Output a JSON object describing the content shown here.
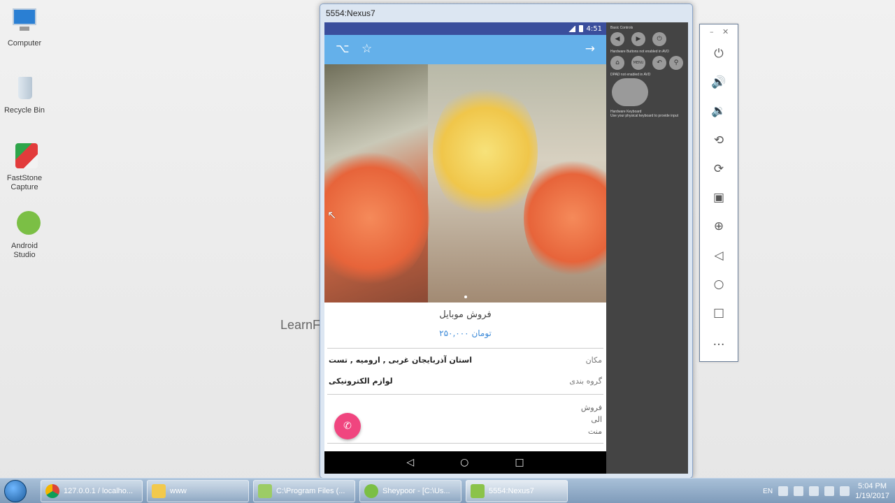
{
  "desktop": {
    "icons": [
      {
        "label": "Computer"
      },
      {
        "label": "Recycle Bin"
      },
      {
        "label": "FastStone Capture"
      },
      {
        "label": "Android Studio"
      }
    ],
    "watermark": "LearnF"
  },
  "emulator": {
    "window_title": "5554:Nexus7",
    "status_time": "4:51",
    "product": {
      "title": "فروش موبایل",
      "price": "۲۵۰,۰۰۰ تومان",
      "rows": [
        {
          "key": "مکان",
          "value": "استان آذربایجان غربی , ارومیه , تست"
        },
        {
          "key": "گروه بندی",
          "value": "لوازم الکترونیکی"
        }
      ],
      "description": [
        "فروش",
        "الی",
        "منت"
      ]
    },
    "controls": {
      "basic_controls": "Basic Controls",
      "hardware_buttons": "Hardware Buttons not enabled in AVD",
      "dpad": "DPAD not enabled in AVD",
      "hardware_keyboard": "Hardware Keyboard",
      "keyboard_hint": "Use your physical keyboard to provide input",
      "menu_label": "MENU"
    }
  },
  "taskbar": {
    "items": [
      {
        "label": "127.0.0.1 / localho..."
      },
      {
        "label": "www"
      },
      {
        "label": "C:\\Program Files (..."
      },
      {
        "label": "Sheypoor - [C:\\Us..."
      },
      {
        "label": "5554:Nexus7"
      }
    ],
    "language": "EN",
    "time": "5:04 PM",
    "date": "1/19/2017"
  }
}
